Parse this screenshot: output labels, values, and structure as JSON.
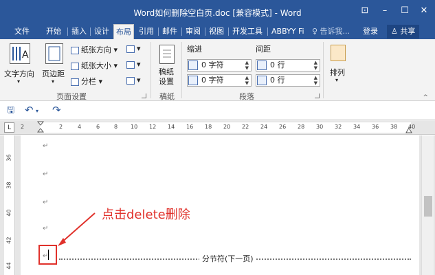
{
  "window": {
    "title": "Word如何删除空白页.doc [兼容模式] - Word",
    "controls": [
      "⊡",
      "–",
      "☐",
      "✕"
    ]
  },
  "tabs": [
    {
      "label": "文件"
    },
    {
      "label": "开始"
    },
    {
      "label": "插入"
    },
    {
      "label": "设计"
    },
    {
      "label": "布局"
    },
    {
      "label": "引用"
    },
    {
      "label": "邮件"
    },
    {
      "label": "审阅"
    },
    {
      "label": "视图"
    },
    {
      "label": "开发工具"
    },
    {
      "label": "ABBYY Fi"
    }
  ],
  "active_tab": "布局",
  "tell_me": "♀ 告诉我...",
  "login": "登录",
  "share": "共享",
  "ribbon": {
    "page_setup": {
      "text_direction": "文字方向",
      "margins": "页边距",
      "orientation": "纸张方向",
      "size": "纸张大小",
      "columns": "分栏",
      "group_label": "页面设置"
    },
    "draft": {
      "button": "稿纸\n设置",
      "group_label": "稿纸"
    },
    "paragraph": {
      "indent_label": "缩进",
      "spacing_label": "间距",
      "indent_left": "0 字符",
      "indent_right": "0 字符",
      "spacing_before": "0 行",
      "spacing_after": "0 行",
      "group_label": "段落"
    },
    "arrange": {
      "button": "排列"
    }
  },
  "ruler_ticks": [
    "2",
    "2",
    "4",
    "6",
    "8",
    "10",
    "12",
    "14",
    "16",
    "18",
    "20",
    "22",
    "24",
    "26",
    "28",
    "30",
    "32",
    "34",
    "36",
    "38",
    "40"
  ],
  "vruler_ticks": [
    "36",
    "38",
    "40",
    "42",
    "44"
  ],
  "document": {
    "paragraph_mark": "↵",
    "section_break": "分节符(下一页)",
    "callout": "点击delete删除"
  },
  "colors": {
    "accent": "#2b579a",
    "callout_red": "#e0312b"
  }
}
